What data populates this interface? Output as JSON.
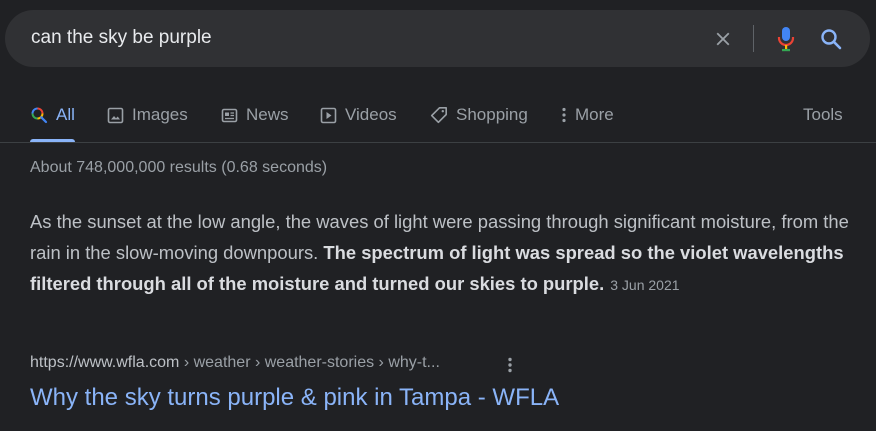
{
  "search": {
    "query": "can the sky be purple",
    "clear_icon": "close-icon",
    "mic_icon": "microphone-icon",
    "search_icon": "search-icon"
  },
  "tabs": [
    {
      "label": "All",
      "icon": "search-multicolor-icon",
      "active": true
    },
    {
      "label": "Images",
      "icon": "image-icon"
    },
    {
      "label": "News",
      "icon": "newspaper-icon"
    },
    {
      "label": "Videos",
      "icon": "play-icon"
    },
    {
      "label": "Shopping",
      "icon": "tag-icon"
    },
    {
      "label": "More",
      "icon": "more-vert-icon"
    }
  ],
  "tools_label": "Tools",
  "result_stats": "About 748,000,000 results (0.68 seconds)",
  "featured_snippet": {
    "text_plain": "As the sunset at the low angle, the waves of light were passing through significant moisture, from the rain in the slow-moving downpours.",
    "text_bold": "The spectrum of light was spread so the violet wavelengths filtered through all of the moisture and turned our skies to purple.",
    "date": "3 Jun 2021"
  },
  "result": {
    "domain": "https://www.wfla.com",
    "breadcrumbs": " › weather › weather-stories › why-t...",
    "title": "Why the sky turns purple & pink in Tampa - WFLA"
  },
  "colors": {
    "background": "#202124",
    "searchbar": "#303134",
    "link": "#8ab4f8",
    "text": "#bdc1c6",
    "muted": "#9aa0a6"
  }
}
